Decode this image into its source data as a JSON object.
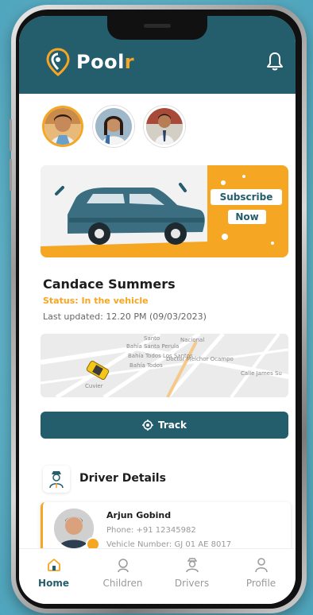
{
  "app": {
    "brand": "Pool",
    "brand_accent": "r",
    "colors": {
      "primary": "#245d6c",
      "accent": "#f5a623"
    }
  },
  "header": {
    "notification_icon": "bell-icon"
  },
  "children": [
    {
      "id": "child-1",
      "selected": true
    },
    {
      "id": "child-2",
      "selected": false
    },
    {
      "id": "child-3",
      "selected": false
    }
  ],
  "banner": {
    "line1": "Subscribe",
    "line2": "Now"
  },
  "child_status": {
    "name": "Candace Summers",
    "status": "Status: In the vehicle",
    "last_updated": "Last updated: 12.20 PM (09/03/2023)"
  },
  "map": {
    "labels": [
      "Santo",
      "Bahía Santa Perula",
      "Nacional",
      "Bahía Todos Los Santos",
      "Bahía Todos",
      "Calle James Su",
      "Cuvier",
      "Doctor Melchor Ocampo"
    ]
  },
  "track_button": {
    "label": "Track",
    "icon": "target-icon"
  },
  "driver_details": {
    "title": "Driver Details",
    "driver": {
      "name": "Arjun Gobind",
      "phone": "Phone: +91 12345982",
      "vehicle": "Vehicle Number: GJ 01 AE 8017"
    }
  },
  "nav": {
    "items": [
      {
        "label": "Home",
        "icon": "home-icon",
        "active": true
      },
      {
        "label": "Children",
        "icon": "children-icon",
        "active": false
      },
      {
        "label": "Drivers",
        "icon": "drivers-icon",
        "active": false
      },
      {
        "label": "Profile",
        "icon": "profile-icon",
        "active": false
      }
    ]
  }
}
